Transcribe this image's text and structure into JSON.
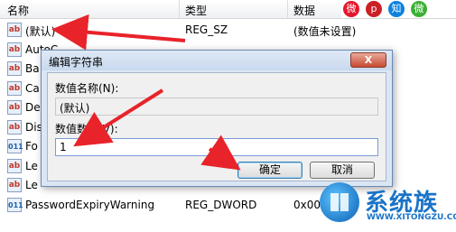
{
  "columns": {
    "name": "名称",
    "type": "类型",
    "data": "数据"
  },
  "rows": [
    {
      "name": "(默认)",
      "type": "REG_SZ",
      "data": "(数值未设置)",
      "icon": "ab"
    },
    {
      "name": "AutoC...",
      "type": "",
      "data": "",
      "icon": "ab"
    },
    {
      "name": "Ba",
      "type": "",
      "data": "",
      "icon": "ab"
    },
    {
      "name": "Ca",
      "type": "",
      "data": "",
      "icon": "ab"
    },
    {
      "name": "De",
      "type": "",
      "data": "",
      "icon": "ab"
    },
    {
      "name": "Dis",
      "type": "",
      "data": "",
      "icon": "ab"
    },
    {
      "name": "Fo",
      "type": "",
      "data": "",
      "icon": "bin"
    },
    {
      "name": "Le",
      "type": "",
      "data": "",
      "icon": "ab"
    },
    {
      "name": "Le",
      "type": "",
      "data": "",
      "icon": "ab"
    },
    {
      "name": "PasswordExpiryWarning",
      "type": "REG_DWORD",
      "data": "0x000...",
      "icon": "bin"
    }
  ],
  "dialog": {
    "title": "编辑字符串",
    "close_label": "X",
    "value_name_label": "数值名称(N):",
    "value_name": "(默认)",
    "value_data_label": "数值数据(V):",
    "value_data": "1",
    "ok_label": "确定",
    "cancel_label": "取消"
  },
  "watermark": {
    "brand": "系统族",
    "url": "WWW.XITONGZU.COM"
  },
  "share_icons": [
    "weibo-icon",
    "pinterest-icon",
    "zhihu-icon",
    "wechat-icon"
  ],
  "colors": {
    "arrow": "#e8232a",
    "accent": "#1a73c7"
  }
}
